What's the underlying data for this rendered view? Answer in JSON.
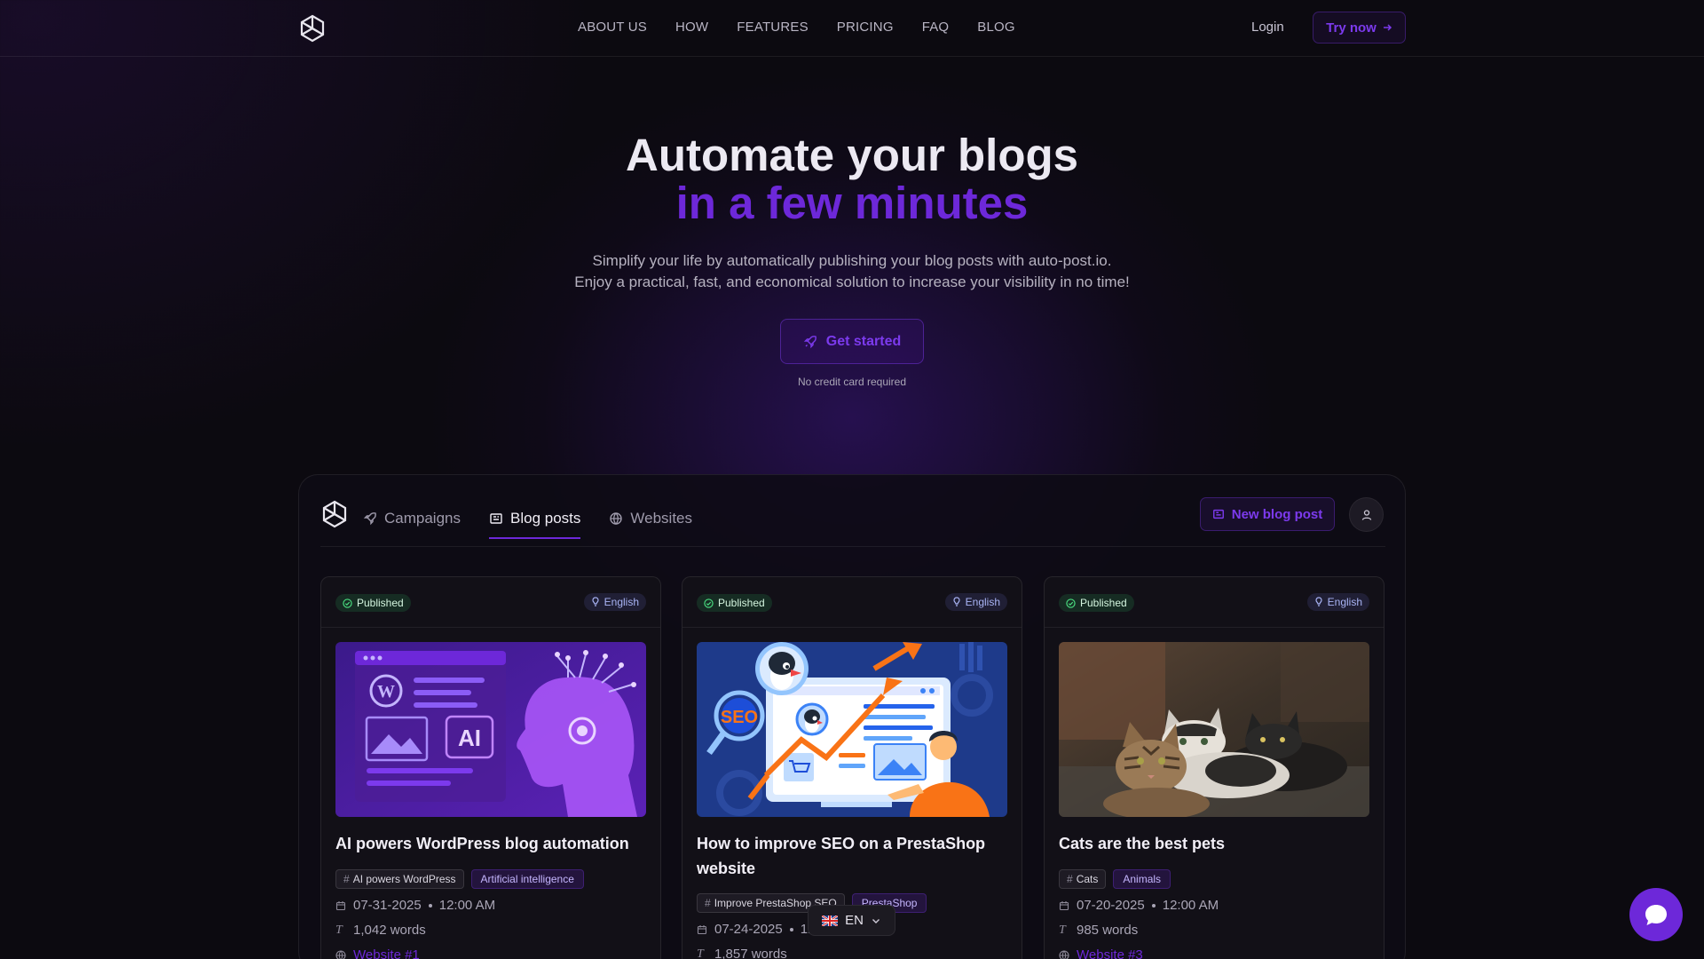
{
  "nav": {
    "links": [
      "ABOUT US",
      "HOW",
      "FEATURES",
      "PRICING",
      "FAQ",
      "BLOG"
    ],
    "login": "Login",
    "try_now": "Try now",
    "try_now_icon": "arrow-right-icon"
  },
  "hero": {
    "title_line1": "Automate your blogs",
    "title_line2": "in a few minutes",
    "subtitle_line1": "Simplify your life by automatically publishing your blog posts with auto-post.io.",
    "subtitle_line2": "Enjoy a practical, fast, and economical solution to increase your visibility in no time!",
    "cta": "Get started",
    "cta_icon": "rocket-icon",
    "note": "No credit card required"
  },
  "app": {
    "tabs": [
      {
        "label": "Campaigns",
        "icon": "rocket-icon",
        "active": false
      },
      {
        "label": "Blog posts",
        "icon": "newspaper-icon",
        "active": true
      },
      {
        "label": "Websites",
        "icon": "globe-icon",
        "active": false
      }
    ],
    "new_post": "New blog post",
    "user_icon": "user-icon"
  },
  "cards": [
    {
      "status": "Published",
      "language": "English",
      "title": "AI powers WordPress blog automation",
      "tag": "AI powers WordPress",
      "category": "Artificial intelligence",
      "date": "07-31-2025",
      "time": "12:00 AM",
      "words": "1,042 words",
      "website": "Website #1"
    },
    {
      "status": "Published",
      "language": "English",
      "title": "How to improve SEO on a PrestaShop website",
      "tag": "Improve PrestaShop SEO",
      "category": "PrestaShop",
      "date": "07-24-2025",
      "time": "12:00 AM",
      "words": "1,857 words",
      "image_text": "SEO"
    },
    {
      "status": "Published",
      "language": "English",
      "title": "Cats are the best pets",
      "tag": "Cats",
      "category": "Animals",
      "date": "07-20-2025",
      "time": "12:00 AM",
      "words": "985 words",
      "website": "Website #3"
    }
  ],
  "card1_image_text": "AI",
  "language_selector": {
    "label": "EN",
    "flag_icon": "uk-flag-icon"
  },
  "colors": {
    "accent": "#6d28d9",
    "background": "#0c0a10",
    "published": "#22c55e"
  }
}
